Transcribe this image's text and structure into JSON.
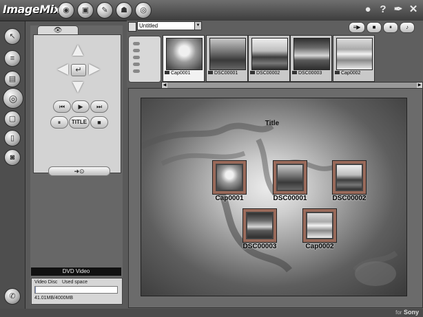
{
  "app": {
    "title": "ImageMixer"
  },
  "top_modes": [
    {
      "name": "capture-mode-icon",
      "glyph": "◉"
    },
    {
      "name": "album-mode-icon",
      "glyph": "▣"
    },
    {
      "name": "edit-mode-icon",
      "glyph": "✎"
    },
    {
      "name": "share-mode-icon",
      "glyph": "☗"
    },
    {
      "name": "dvd-mode-icon",
      "glyph": "◎"
    }
  ],
  "system_buttons": [
    {
      "name": "user-icon",
      "glyph": "●"
    },
    {
      "name": "help-icon",
      "glyph": "?"
    },
    {
      "name": "tools-icon",
      "glyph": "✒"
    },
    {
      "name": "close-icon",
      "glyph": "✕"
    }
  ],
  "left_tools": [
    {
      "name": "select-tool-icon",
      "glyph": "↖",
      "active": false
    },
    {
      "name": "list-tool-icon",
      "glyph": "≡",
      "active": false
    },
    {
      "name": "book-tool-icon",
      "glyph": "▤",
      "active": false
    },
    {
      "name": "disc-tool-icon",
      "glyph": "◎",
      "active": true
    },
    {
      "name": "save-tool-icon",
      "glyph": "▢",
      "active": false
    },
    {
      "name": "document-tool-icon",
      "glyph": "▯",
      "active": false
    },
    {
      "name": "disc-burn-tool-icon",
      "glyph": "◙",
      "active": false
    }
  ],
  "panel": {
    "tab_icon": "👁",
    "remote": {
      "enter": "↵",
      "rew": "⏮",
      "play": "▶",
      "ff": "⏭",
      "pause": "⏸",
      "title": "TITLE",
      "stop": "■",
      "write": "➜⊙"
    },
    "dvd_label": "DVD Video",
    "disc": {
      "type": "Video Disc",
      "used_label": "Used space",
      "capacity": "41.01MB/4000MB",
      "used_fraction": 0.01
    }
  },
  "strip": {
    "album_select": "Untitled",
    "buttons": [
      {
        "name": "transfer-button",
        "label": "≡▶"
      },
      {
        "name": "stop-button",
        "label": "■"
      },
      {
        "name": "pause-button",
        "label": "⏸"
      },
      {
        "name": "music-button",
        "label": "♪"
      }
    ],
    "thumbnails": [
      {
        "label": "Cap0001",
        "img": "img-flower",
        "selected": true
      },
      {
        "label": "DSC00001",
        "img": "img-canal",
        "selected": false
      },
      {
        "label": "DSC00002",
        "img": "img-field",
        "selected": false
      },
      {
        "label": "DSC00003",
        "img": "img-sky",
        "selected": false
      },
      {
        "label": "Cap0002",
        "img": "img-flowers2",
        "selected": false
      }
    ],
    "scroll_left": "◀",
    "scroll_right": "▶"
  },
  "preview": {
    "menu_title": "Title",
    "items": [
      {
        "label": "Cap0001",
        "img": "img-flower"
      },
      {
        "label": "DSC00001",
        "img": "img-canal"
      },
      {
        "label": "DSC00002",
        "img": "img-field"
      },
      {
        "label": "DSC00003",
        "img": "img-sky"
      },
      {
        "label": "Cap0002",
        "img": "img-flowers2"
      }
    ]
  },
  "brand": {
    "prefix": "for",
    "name": "Sony"
  }
}
